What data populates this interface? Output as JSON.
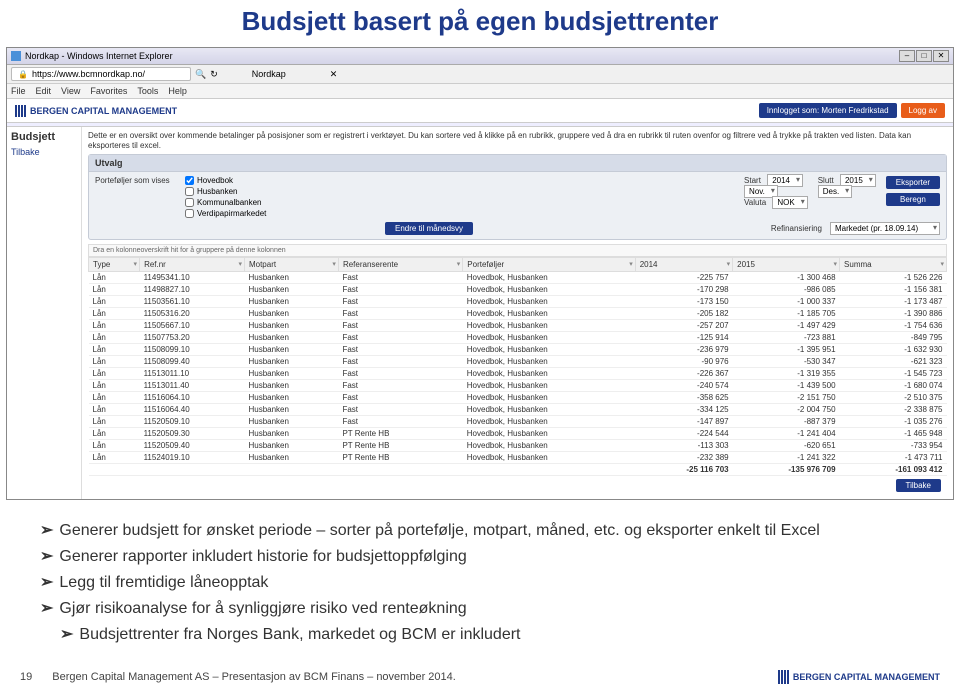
{
  "slide_title": "Budsjett basert på egen budsjettrenter",
  "browser": {
    "title": "Nordkap - Windows Internet Explorer",
    "url": "https://www.bcmnordkap.no/",
    "tab": "Nordkap",
    "menu": [
      "File",
      "Edit",
      "View",
      "Favorites",
      "Tools",
      "Help"
    ]
  },
  "app": {
    "brand": "BERGEN CAPITAL MANAGEMENT",
    "user_label": "Innlogget som: Morten Fredrikstad",
    "logout": "Logg av"
  },
  "sidebar": {
    "title": "Budsjett",
    "back": "Tilbake"
  },
  "intro": "Dette er en oversikt over kommende betalinger på posisjoner som er registrert i verktøyet. Du kan sortere ved å klikke på en rubrikk, gruppere ved å dra en rubrikk til ruten ovenfor og filtrere ved å trykke på trakten ved listen. Data kan eksporteres til excel.",
  "panel": {
    "title": "Utvalg",
    "portf_label": "Porteføljer som vises",
    "checks": [
      {
        "label": "Hovedbok",
        "checked": true
      },
      {
        "label": "Husbanken",
        "checked": false
      },
      {
        "label": "Kommunalbanken",
        "checked": false
      },
      {
        "label": "Verdipapirmarkedet",
        "checked": false
      }
    ],
    "start_label": "Start",
    "start_year": "2014",
    "start_month": "Nov.",
    "slutt_label": "Slutt",
    "slutt_year": "2015",
    "slutt_month": "Des.",
    "valuta_label": "Valuta",
    "valuta": "NOK",
    "eksporter": "Eksporter",
    "beregn": "Beregn",
    "endre": "Endre til månedsvy",
    "refin_label": "Refinansiering",
    "refin_value": "Markedet (pr. 18.09.14)"
  },
  "table": {
    "group_hint": "Dra en kolonneoverskrift hit for å gruppere på denne kolonnen",
    "headers": [
      "Type",
      "Ref.nr",
      "Motpart",
      "Referanserente",
      "Porteføljer",
      "2014",
      "2015",
      "Summa"
    ],
    "rows": [
      [
        "Lån",
        "11495341.10",
        "Husbanken",
        "Fast",
        "Hovedbok, Husbanken",
        "-225 757",
        "-1 300 468",
        "-1 526 226"
      ],
      [
        "Lån",
        "11498827.10",
        "Husbanken",
        "Fast",
        "Hovedbok, Husbanken",
        "-170 298",
        "-986 085",
        "-1 156 381"
      ],
      [
        "Lån",
        "11503561.10",
        "Husbanken",
        "Fast",
        "Hovedbok, Husbanken",
        "-173 150",
        "-1 000 337",
        "-1 173 487"
      ],
      [
        "Lån",
        "11505316.20",
        "Husbanken",
        "Fast",
        "Hovedbok, Husbanken",
        "-205 182",
        "-1 185 705",
        "-1 390 886"
      ],
      [
        "Lån",
        "11505667.10",
        "Husbanken",
        "Fast",
        "Hovedbok, Husbanken",
        "-257 207",
        "-1 497 429",
        "-1 754 636"
      ],
      [
        "Lån",
        "11507753.20",
        "Husbanken",
        "Fast",
        "Hovedbok, Husbanken",
        "-125 914",
        "-723 881",
        "-849 795"
      ],
      [
        "Lån",
        "11508099.10",
        "Husbanken",
        "Fast",
        "Hovedbok, Husbanken",
        "-236 979",
        "-1 395 951",
        "-1 632 930"
      ],
      [
        "Lån",
        "11508099.40",
        "Husbanken",
        "Fast",
        "Hovedbok, Husbanken",
        "-90 976",
        "-530 347",
        "-621 323"
      ],
      [
        "Lån",
        "11513011.10",
        "Husbanken",
        "Fast",
        "Hovedbok, Husbanken",
        "-226 367",
        "-1 319 355",
        "-1 545 723"
      ],
      [
        "Lån",
        "11513011.40",
        "Husbanken",
        "Fast",
        "Hovedbok, Husbanken",
        "-240 574",
        "-1 439 500",
        "-1 680 074"
      ],
      [
        "Lån",
        "11516064.10",
        "Husbanken",
        "Fast",
        "Hovedbok, Husbanken",
        "-358 625",
        "-2 151 750",
        "-2 510 375"
      ],
      [
        "Lån",
        "11516064.40",
        "Husbanken",
        "Fast",
        "Hovedbok, Husbanken",
        "-334 125",
        "-2 004 750",
        "-2 338 875"
      ],
      [
        "Lån",
        "11520509.10",
        "Husbanken",
        "Fast",
        "Hovedbok, Husbanken",
        "-147 897",
        "-887 379",
        "-1 035 276"
      ],
      [
        "Lån",
        "11520509.30",
        "Husbanken",
        "PT Rente HB",
        "Hovedbok, Husbanken",
        "-224 544",
        "-1 241 404",
        "-1 465 948"
      ],
      [
        "Lån",
        "11520509.40",
        "Husbanken",
        "PT Rente HB",
        "Hovedbok, Husbanken",
        "-113 303",
        "-620 651",
        "-733 954"
      ],
      [
        "Lån",
        "11524019.10",
        "Husbanken",
        "PT Rente HB",
        "Hovedbok, Husbanken",
        "-232 389",
        "-1 241 322",
        "-1 473 711"
      ]
    ],
    "footer": [
      "",
      "",
      "",
      "",
      "",
      "-25 116 703",
      "-135 976 709",
      "-161 093 412"
    ],
    "back": "Tilbake"
  },
  "bullets": [
    "Generer budsjett for ønsket periode – sorter på portefølje, motpart, måned, etc. og eksporter enkelt til Excel",
    "Generer rapporter inkludert historie for budsjettoppfølging",
    "Legg til fremtidige låneopptak",
    "Gjør risikoanalyse for å synliggjøre risiko ved renteøkning",
    "Budsjettrenter fra Norges Bank, markedet og BCM er inkludert"
  ],
  "footer": {
    "page": "19",
    "text": "Bergen Capital Management AS – Presentasjon av BCM Finans – november 2014.",
    "brand": "BERGEN CAPITAL MANAGEMENT"
  }
}
